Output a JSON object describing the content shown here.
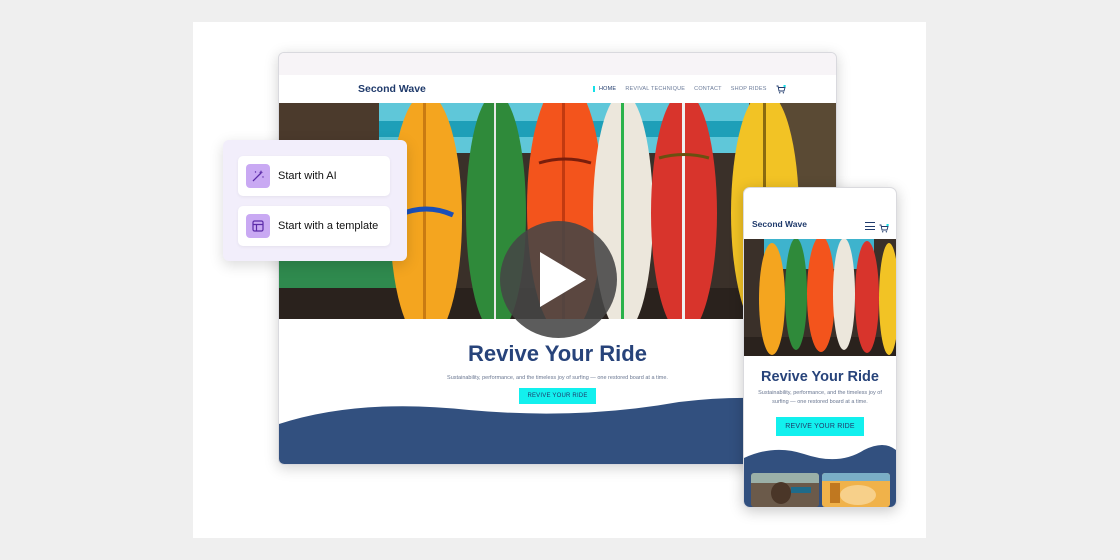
{
  "desktop": {
    "brand": "Second Wave",
    "nav": [
      "HOME",
      "REVIVAL TECHNIQUE",
      "CONTACT",
      "SHOP RIDES"
    ],
    "headline": "Revive Your Ride",
    "subheadline": "Sustainability, performance, and the timeless joy of surfing — one restored board at a time.",
    "cta": "REVIVE YOUR RIDE"
  },
  "options": [
    {
      "label": "Start with AI",
      "icon": "magic-wand-icon"
    },
    {
      "label": "Start with a template",
      "icon": "template-layout-icon"
    }
  ],
  "mobile": {
    "brand": "Second Wave",
    "headline": "Revive Your Ride",
    "subheadline": "Sustainability, performance, and the timeless joy of surfing — one restored board at a time.",
    "cta": "REVIVE YOUR RIDE"
  },
  "colors": {
    "brand_navy": "#1f3a6b",
    "wave_navy": "#32507f",
    "accent_cyan": "#12f0ee",
    "option_icon": "#c9a9f3"
  }
}
